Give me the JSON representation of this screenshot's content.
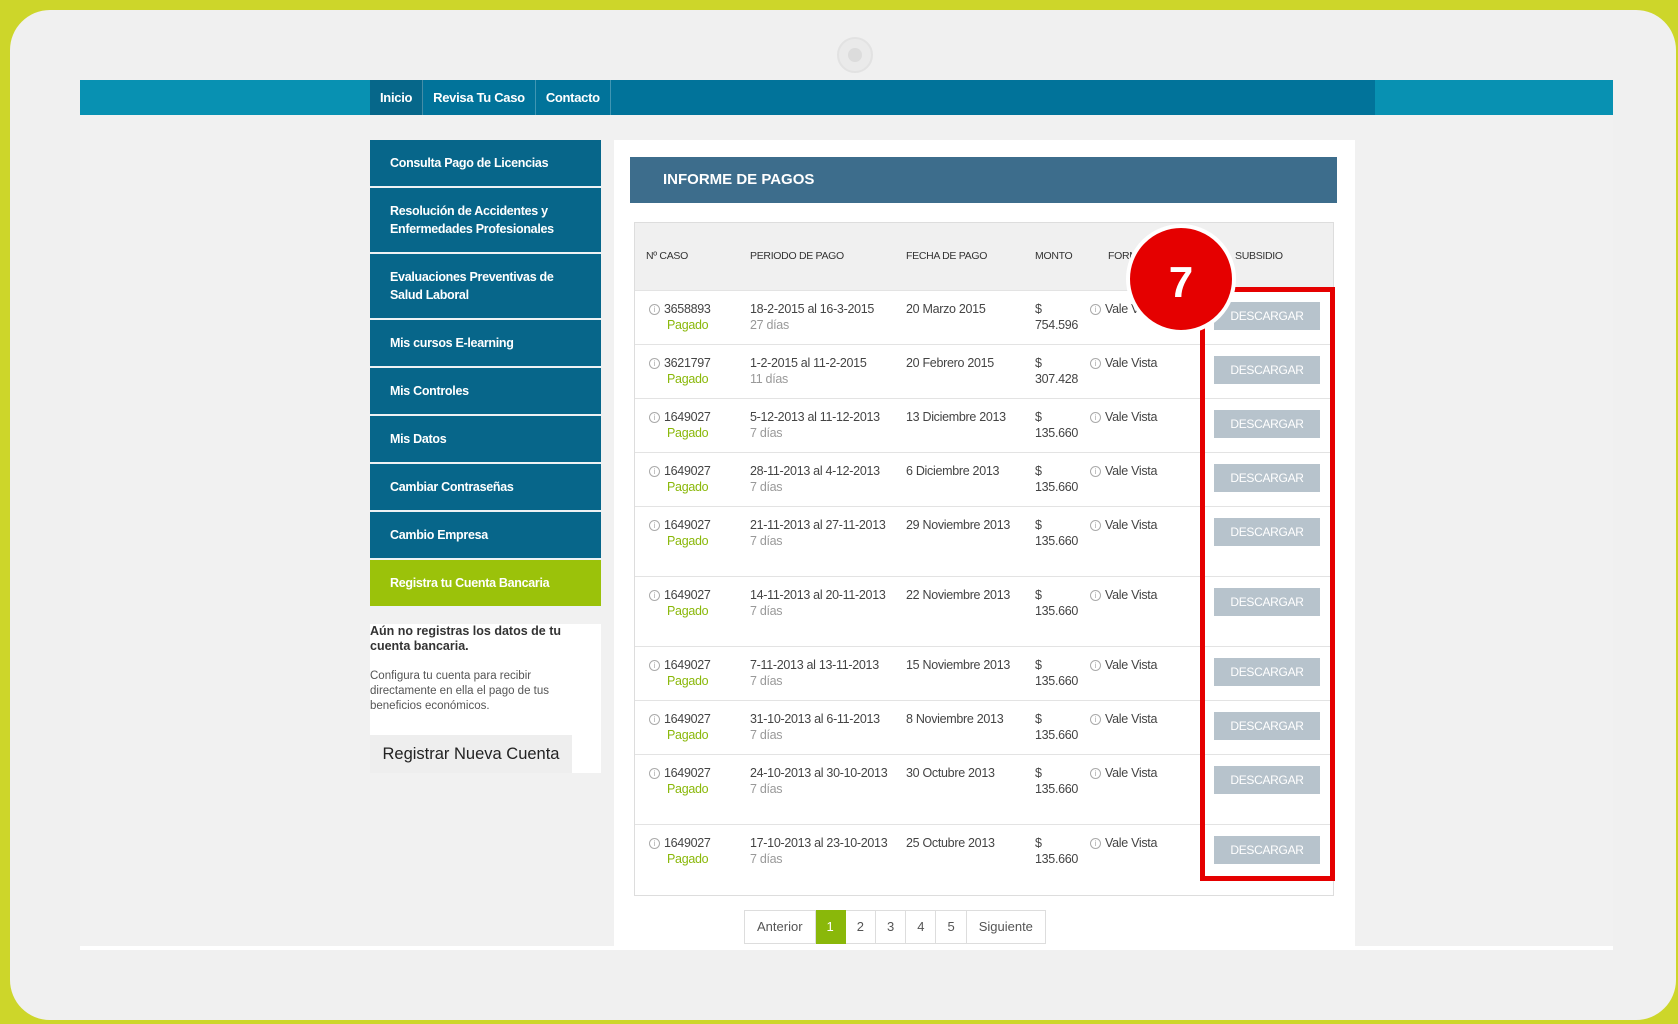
{
  "nav": {
    "items": [
      "Inicio",
      "Revisa Tu Caso",
      "Contacto"
    ]
  },
  "sidebar": {
    "items": [
      {
        "label": "Consulta Pago de Licencias"
      },
      {
        "label": "Resolución de Accidentes y Enfermedades Profesionales"
      },
      {
        "label": "Evaluaciones Preventivas de Salud Laboral"
      },
      {
        "label": "Mis cursos E-learning"
      },
      {
        "label": "Mis Controles"
      },
      {
        "label": "Mis Datos"
      },
      {
        "label": "Cambiar Contraseñas"
      },
      {
        "label": "Cambio Empresa"
      },
      {
        "label": "Registra tu Cuenta Bancaria"
      }
    ],
    "notice_title": "Aún no registras los datos de tu cuenta bancaria.",
    "notice_text": "Configura tu cuenta para recibir directamente en ella el pago de tus beneficios económicos.",
    "register_button": "Registrar Nueva Cuenta"
  },
  "main": {
    "title": "INFORME DE PAGOS",
    "columns": {
      "caso": "Nº CASO",
      "periodo": "PERIODO DE PAGO",
      "fecha": "FECHA DE PAGO",
      "monto": "MONTO",
      "forma": "FORMA",
      "subsidio": "SUBSIDIO"
    },
    "status_label": "Pagado",
    "download_label": "DESCARGAR",
    "rows": [
      {
        "caso": "3658893",
        "periodo": "18-2-2015 al 16-3-2015",
        "dias": "27 días",
        "fecha": "20 Marzo 2015",
        "monto_sym": "$",
        "monto": "754.596",
        "forma": "Vale Vista"
      },
      {
        "caso": "3621797",
        "periodo": "1-2-2015 al 11-2-2015",
        "dias": "11 días",
        "fecha": "20 Febrero 2015",
        "monto_sym": "$",
        "monto": "307.428",
        "forma": "Vale Vista"
      },
      {
        "caso": "1649027",
        "periodo": "5-12-2013 al 11-12-2013",
        "dias": "7 días",
        "fecha": "13 Diciembre 2013",
        "monto_sym": "$",
        "monto": "135.660",
        "forma": "Vale Vista"
      },
      {
        "caso": "1649027",
        "periodo": "28-11-2013 al 4-12-2013",
        "dias": "7 días",
        "fecha": "6 Diciembre 2013",
        "monto_sym": "$",
        "monto": "135.660",
        "forma": "Vale Vista"
      },
      {
        "caso": "1649027",
        "periodo": "21-11-2013 al 27-11-2013",
        "dias": "7 días",
        "fecha": "29 Noviembre 2013",
        "monto_sym": "$",
        "monto": "135.660",
        "forma": "Vale Vista"
      },
      {
        "caso": "1649027",
        "periodo": "14-11-2013 al 20-11-2013",
        "dias": "7 días",
        "fecha": "22 Noviembre 2013",
        "monto_sym": "$",
        "monto": "135.660",
        "forma": "Vale Vista"
      },
      {
        "caso": "1649027",
        "periodo": "7-11-2013 al 13-11-2013",
        "dias": "7 días",
        "fecha": "15 Noviembre 2013",
        "monto_sym": "$",
        "monto": "135.660",
        "forma": "Vale Vista"
      },
      {
        "caso": "1649027",
        "periodo": "31-10-2013 al 6-11-2013",
        "dias": "7 días",
        "fecha": "8 Noviembre 2013",
        "monto_sym": "$",
        "monto": "135.660",
        "forma": "Vale Vista"
      },
      {
        "caso": "1649027",
        "periodo": "24-10-2013 al 30-10-2013",
        "dias": "7 días",
        "fecha": "30 Octubre 2013",
        "monto_sym": "$",
        "monto": "135.660",
        "forma": "Vale Vista"
      },
      {
        "caso": "1649027",
        "periodo": "17-10-2013 al 23-10-2013",
        "dias": "7 días",
        "fecha": "25 Octubre 2013",
        "monto_sym": "$",
        "monto": "135.660",
        "forma": "Vale Vista"
      }
    ]
  },
  "pagination": {
    "prev": "Anterior",
    "pages": [
      "1",
      "2",
      "3",
      "4",
      "5"
    ],
    "current": "1",
    "next": "Siguiente"
  },
  "annotation": {
    "number": "7"
  },
  "colors": {
    "frame": "#cdd62a",
    "nav": "#01739a",
    "sidebar": "#07668a",
    "sidebar_active": "#9bc20a",
    "title_bar": "#3d6d8c",
    "paid": "#8ab80a",
    "download": "#b7c3cc",
    "highlight": "#e50000"
  }
}
